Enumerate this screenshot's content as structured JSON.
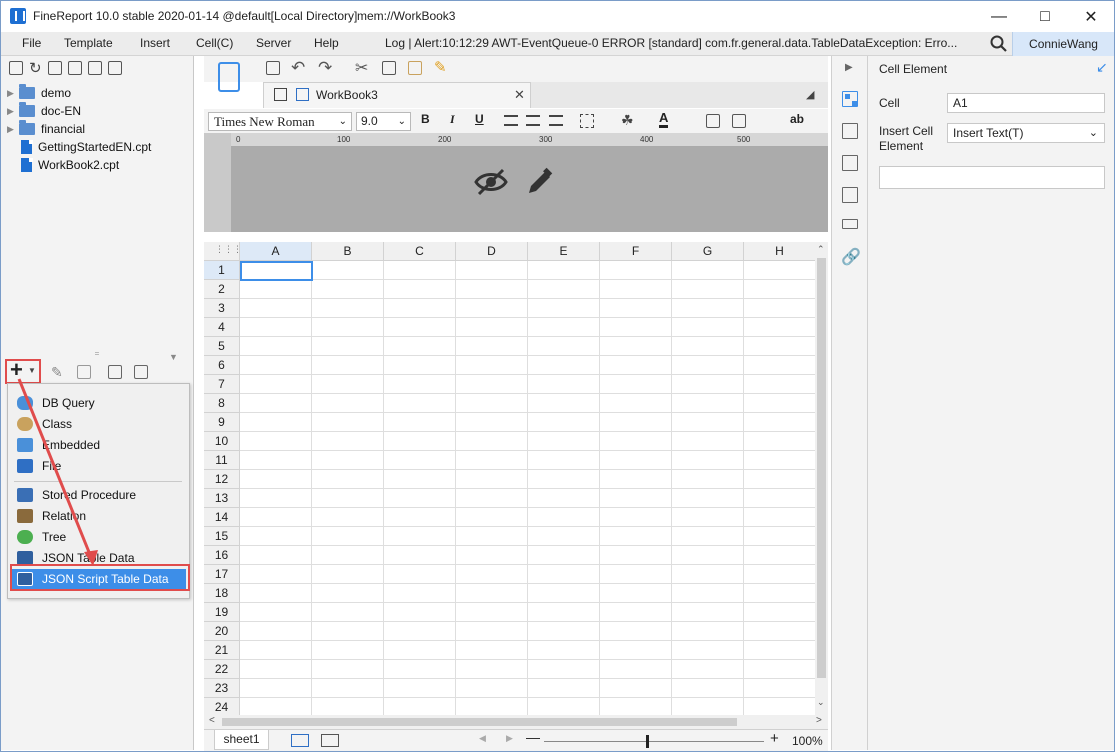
{
  "window": {
    "title": "FineReport 10.0 stable 2020-01-14 @default[Local Directory]",
    "path": "mem://WorkBook3"
  },
  "menubar": {
    "items": [
      "File",
      "Template",
      "Insert",
      "Cell(C)",
      "Server",
      "Help"
    ],
    "log": "Log | Alert:10:12:29 AWT-EventQueue-0 ERROR [standard] com.fr.general.data.TableDataException: Erro...",
    "user": "ConnieWang"
  },
  "tree": {
    "items": [
      {
        "label": "demo",
        "type": "folder"
      },
      {
        "label": "doc-EN",
        "type": "folder"
      },
      {
        "label": "financial",
        "type": "folder"
      },
      {
        "label": "GettingStartedEN.cpt",
        "type": "file"
      },
      {
        "label": "WorkBook2.cpt",
        "type": "file"
      }
    ]
  },
  "dataset_menu": {
    "items": [
      {
        "label": "DB Query",
        "icon": "db-icon",
        "color": "#4a90d9"
      },
      {
        "label": "Class",
        "icon": "class-icon",
        "color": "#c9a25e"
      },
      {
        "label": "Embedded",
        "icon": "embedded-icon",
        "color": "#4a90d9"
      },
      {
        "label": "File",
        "icon": "file-icon",
        "color": "#2f6fc4"
      },
      {
        "label": "Stored Procedure",
        "icon": "procedure-icon",
        "color": "#3a6fb5"
      },
      {
        "label": "Relation",
        "icon": "relation-icon",
        "color": "#8a6a3c"
      },
      {
        "label": "Tree",
        "icon": "tree-icon",
        "color": "#4caf50"
      },
      {
        "label": "JSON Table Data",
        "icon": "json-icon",
        "color": "#2f5f9e"
      },
      {
        "label": "JSON Script Table Data",
        "icon": "json-icon",
        "color": "#2f5f9e"
      }
    ],
    "selected": "JSON Script Table Data"
  },
  "editor": {
    "tab": "WorkBook3",
    "font": "Times New Roman",
    "size": "9.0",
    "bold": "B",
    "italic": "I",
    "underline": "U",
    "wrap": "ab"
  },
  "ruler": [
    "0",
    "100",
    "200",
    "300",
    "400",
    "500"
  ],
  "grid": {
    "columns": [
      "A",
      "B",
      "C",
      "D",
      "E",
      "F",
      "G",
      "H"
    ],
    "rows": [
      "1",
      "2",
      "3",
      "4",
      "5",
      "6",
      "7",
      "8",
      "9",
      "10",
      "11",
      "12",
      "13",
      "14",
      "15",
      "16",
      "17",
      "18",
      "19",
      "20",
      "21",
      "22",
      "23",
      "24"
    ],
    "selected_cell": "A1"
  },
  "bottom": {
    "sheet": "sheet1",
    "zoom": "100%"
  },
  "rpanel": {
    "title": "Cell Element",
    "cell_label": "Cell",
    "cell_value": "A1",
    "insert_label1": "Insert Cell",
    "insert_label2": "Element",
    "insert_value": "Insert Text(T)"
  },
  "colors": {
    "accent": "#3d8ee8",
    "highlight": "#e04c4c"
  }
}
